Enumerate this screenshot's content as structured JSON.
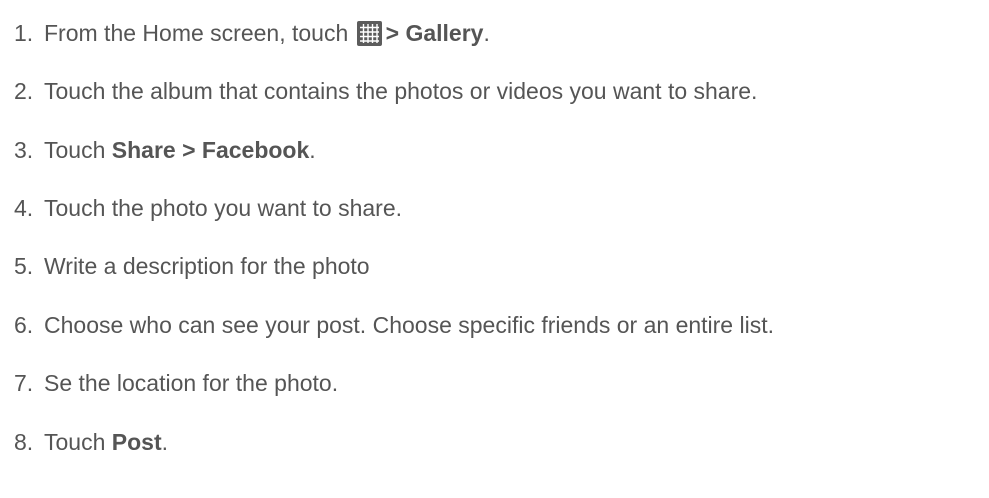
{
  "steps": [
    {
      "number": "1.",
      "text_before": "From the Home screen, touch",
      "icon": "apps-grid-icon",
      "bold": "> Gallery",
      "text_after": "."
    },
    {
      "number": "2.",
      "text": "Touch the album that contains the photos or videos you want to share."
    },
    {
      "number": "3.",
      "text_before": "Touch ",
      "bold": "Share > Facebook",
      "text_after": "."
    },
    {
      "number": "4.",
      "text": "Touch the photo you want to share."
    },
    {
      "number": "5.",
      "text": "Write a description for the photo"
    },
    {
      "number": "6.",
      "text": "Choose who can see your post. Choose specific friends or an entire list."
    },
    {
      "number": "7.",
      "text": "Se the location for the photo."
    },
    {
      "number": "8.",
      "text_before": "Touch ",
      "bold": "Post",
      "text_after": "."
    }
  ],
  "colors": {
    "text": "#555555",
    "icon_fill": "#5c5c5c",
    "icon_grid": "#ffffff"
  }
}
